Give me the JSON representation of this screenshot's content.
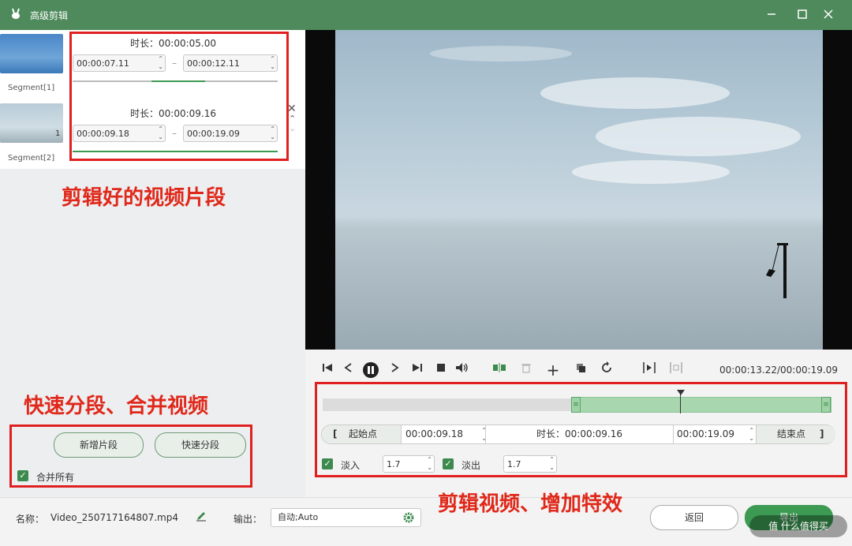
{
  "window": {
    "title": "高级剪辑",
    "icons": {
      "app": "rabbit-logo-icon",
      "minimize": "minimize-icon",
      "maximize": "maximize-icon",
      "close": "close-icon"
    }
  },
  "segments": [
    {
      "label": "Segment[1]",
      "duration_label": "时长：",
      "duration": "00:00:05.00",
      "start": "00:00:07.11",
      "end": "00:00:12.11",
      "separator": "–",
      "progress": 0.6
    },
    {
      "label": "Segment[2]",
      "duration_label": "时长：",
      "duration": "00:00:09.16",
      "start": "00:00:09.18",
      "end": "00:00:19.09",
      "separator": "–",
      "progress": 1.0,
      "badge": "1"
    }
  ],
  "segment_actions": {
    "delete_icon": "close-icon",
    "up_icon": "chevron-up-icon",
    "down_icon": "chevron-down-icon"
  },
  "left_buttons": {
    "add_segment": "新增片段",
    "quick_split": "快速分段",
    "merge_all": "合并所有"
  },
  "annotations": {
    "segments": "剪辑好的视频片段",
    "split_merge": "快速分段、合并视频",
    "edit_effects": "剪辑视频、增加特效"
  },
  "player": {
    "time_display": "00:00:13.22/00:00:19.09",
    "controls": [
      "skip-to-start-icon",
      "step-back-icon",
      "pause-icon",
      "step-forward-icon",
      "skip-to-end-icon",
      "stop-icon",
      "volume-icon",
      "split-icon",
      "delete-icon",
      "add-icon",
      "copy-icon",
      "reset-icon",
      "play-selection-icon",
      "loop-selection-icon"
    ],
    "playhead_progress": 0.72
  },
  "trim": {
    "start_button": "起始点",
    "start_bracket": "[",
    "start_time": "00:00:09.18",
    "duration_label": "时长：",
    "duration": "00:00:09.16",
    "end_time": "00:00:19.09",
    "end_button": "结束点",
    "end_bracket": "]",
    "fade_in_label": "淡入",
    "fade_in_value": "1.7",
    "fade_out_label": "淡出",
    "fade_out_value": "1.7"
  },
  "bottom": {
    "name_label": "名称：",
    "filename": "Video_250717164807.mp4",
    "output_label": "输出：",
    "output_value": "自动;Auto",
    "back_button": "返回",
    "export_button": "导出",
    "watermark": "值 什么值得买"
  },
  "colors": {
    "accent": "#4e8a5b",
    "annotation": "#e0281a",
    "progress": "#3c9a52"
  }
}
